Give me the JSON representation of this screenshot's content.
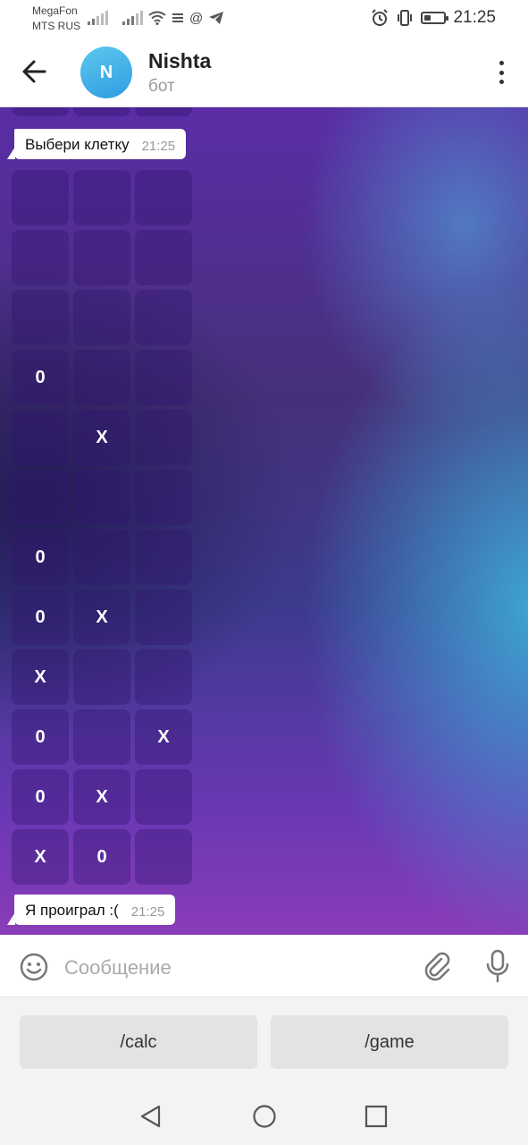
{
  "status_bar": {
    "carrier1": "MegaFon",
    "carrier2": "MTS RUS",
    "time": "21:25",
    "battery_level": 0.35,
    "icons": [
      "signal-icon",
      "signal-icon",
      "wifi-icon",
      "menu-lines-icon",
      "at-icon",
      "telegram-icon",
      "alarm-icon",
      "vibrate-icon",
      "battery-icon"
    ]
  },
  "header": {
    "title": "Nishta",
    "subtitle": "бот",
    "avatar_letter": "N",
    "avatar_color": "#3aa6e6"
  },
  "messages": [
    {
      "text": "Выбери клетку",
      "time": "21:25"
    },
    {
      "text": "Я проиграл :(",
      "time": "21:25"
    }
  ],
  "board_rows": [
    [
      "",
      "",
      ""
    ],
    [
      "",
      "",
      ""
    ],
    [
      "",
      "",
      ""
    ],
    [
      "0",
      "",
      ""
    ],
    [
      "",
      "X",
      ""
    ],
    [
      "",
      "",
      ""
    ],
    [
      "0",
      "",
      ""
    ],
    [
      "0",
      "X",
      ""
    ],
    [
      "X",
      "",
      ""
    ],
    [
      "0",
      "",
      "X"
    ],
    [
      "0",
      "X",
      ""
    ],
    [
      "X",
      "0",
      ""
    ]
  ],
  "composer": {
    "placeholder": "Сообщение"
  },
  "keyboard": {
    "buttons": [
      "/calc",
      "/game"
    ]
  },
  "colors": {
    "accent": "#3aa6e6",
    "chat_bg_purple": "#5a2da6",
    "chat_bg_blue": "#3eaad7"
  }
}
